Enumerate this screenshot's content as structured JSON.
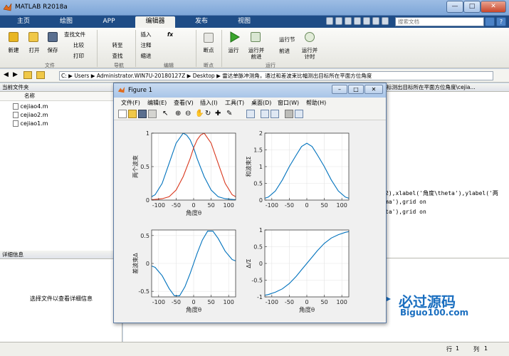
{
  "window": {
    "title": "MATLAB R2018a",
    "min": "—",
    "max": "□",
    "close": "✕"
  },
  "tabs": [
    "主页",
    "绘图",
    "APP",
    "编辑器",
    "发布",
    "视图"
  ],
  "search_placeholder": "搜索文档",
  "help": "?",
  "ribbon": {
    "file_group": {
      "label": "文件",
      "new": "新建",
      "open": "打开",
      "save": "保存",
      "find_files": "查找文件",
      "compare": "比较",
      "print": "打印"
    },
    "nav_group": {
      "label": "导航",
      "goto": "转至",
      "find": "查找"
    },
    "edit_group": {
      "label": "编辑",
      "insert": "插入",
      "comment": "注释",
      "indent": "缩进",
      "fx": "fx"
    },
    "breakpoint_group": {
      "label": "断点",
      "breakpoints": "断点"
    },
    "run_group": {
      "label": "运行",
      "run": "运行",
      "run_advance": "运行并\n前进",
      "run_section": "运行节",
      "advance": "前进",
      "run_time": "运行并\n计时"
    }
  },
  "path": {
    "segments": [
      "C:",
      "Users",
      "Administrator.WIN7U-20180127Z",
      "Desktop",
      "雷达单脉冲测角，通过和差波束比幅测出目标所在平面方位角度"
    ]
  },
  "current_folder": {
    "title": "当前文件夹",
    "column": "名称",
    "files": [
      "cejiao4.m",
      "cejiao2.m",
      "cejiao1.m"
    ]
  },
  "details": {
    "title": "详细信息",
    "hint": "选择文件以查看详细信息"
  },
  "editor": {
    "tab_title": "标测出目标所在平面方位角度\\cejia...",
    "lines": [
      "2),xlabel('角度\\theta'),ylabel('两",
      "ma'),grid on",
      "ta'),grid on"
    ]
  },
  "status": {
    "row_label": "行",
    "row": "1",
    "col_label": "列",
    "col": "1"
  },
  "watermark": {
    "cn": "必过源码",
    "en": "Biguo100.com"
  },
  "figure": {
    "title": "Figure 1",
    "menu": [
      "文件(F)",
      "编辑(E)",
      "查看(V)",
      "插入(I)",
      "工具(T)",
      "桌面(D)",
      "窗口(W)",
      "帮助(H)"
    ]
  },
  "colors": {
    "blue": "#0072bd",
    "red": "#d9381e",
    "tab_blue": "#1e4c86"
  },
  "chart_data": [
    {
      "type": "line",
      "xlabel": "角度θ",
      "ylabel": "两个波束",
      "xlim": [
        -120,
        120
      ],
      "ylim": [
        0,
        1
      ],
      "xticks": [
        -100,
        -50,
        0,
        50,
        100
      ],
      "yticks": [
        0,
        0.5,
        1
      ],
      "grid": true,
      "series": [
        {
          "color": "#0072bd",
          "x": [
            -130,
            -110,
            -90,
            -70,
            -50,
            -30,
            -20,
            -10,
            0,
            10,
            30,
            50,
            70,
            90,
            110,
            130
          ],
          "y": [
            0.02,
            0.08,
            0.25,
            0.55,
            0.85,
            1.0,
            0.97,
            0.9,
            0.78,
            0.62,
            0.35,
            0.15,
            0.05,
            0.02,
            0.01,
            0.0
          ]
        },
        {
          "color": "#d9381e",
          "x": [
            -130,
            -110,
            -90,
            -70,
            -50,
            -30,
            -10,
            0,
            10,
            20,
            30,
            50,
            70,
            90,
            110,
            130
          ],
          "y": [
            0.0,
            0.01,
            0.02,
            0.05,
            0.15,
            0.35,
            0.62,
            0.78,
            0.9,
            0.97,
            1.0,
            0.85,
            0.55,
            0.25,
            0.08,
            0.02
          ]
        }
      ]
    },
    {
      "type": "line",
      "xlabel": "",
      "ylabel": "和波束Σ",
      "xlim": [
        -120,
        120
      ],
      "ylim": [
        0,
        2
      ],
      "xticks": [
        -100,
        -50,
        0,
        50,
        100
      ],
      "yticks": [
        0,
        0.5,
        1,
        1.5,
        2
      ],
      "grid": true,
      "series": [
        {
          "color": "#0072bd",
          "x": [
            -130,
            -110,
            -90,
            -70,
            -50,
            -30,
            -15,
            0,
            15,
            30,
            50,
            70,
            90,
            110,
            130
          ],
          "y": [
            0.02,
            0.09,
            0.27,
            0.6,
            1.0,
            1.35,
            1.6,
            1.7,
            1.6,
            1.35,
            1.0,
            0.6,
            0.27,
            0.09,
            0.02
          ]
        }
      ]
    },
    {
      "type": "line",
      "xlabel": "角度θ",
      "ylabel": "差波束Δ",
      "xlim": [
        -120,
        120
      ],
      "ylim": [
        -0.6,
        0.6
      ],
      "xticks": [
        -100,
        -50,
        0,
        50,
        100
      ],
      "yticks": [
        -0.5,
        0,
        0.5
      ],
      "grid": true,
      "series": [
        {
          "color": "#0072bd",
          "x": [
            -130,
            -110,
            -90,
            -70,
            -55,
            -40,
            -25,
            -10,
            0,
            10,
            25,
            40,
            55,
            70,
            90,
            110,
            130
          ],
          "y": [
            -0.02,
            -0.07,
            -0.22,
            -0.45,
            -0.58,
            -0.58,
            -0.42,
            -0.18,
            0,
            0.18,
            0.42,
            0.58,
            0.58,
            0.45,
            0.22,
            0.07,
            0.02
          ]
        }
      ]
    },
    {
      "type": "line",
      "xlabel": "角度θ",
      "ylabel": "Δ/Σ",
      "xlim": [
        -120,
        120
      ],
      "ylim": [
        -1,
        1
      ],
      "xticks": [
        -100,
        -50,
        0,
        50,
        100
      ],
      "yticks": [
        -1,
        -0.5,
        0,
        0.5,
        1
      ],
      "grid": true,
      "series": [
        {
          "color": "#0072bd",
          "x": [
            -130,
            -110,
            -90,
            -70,
            -50,
            -30,
            -15,
            0,
            15,
            30,
            50,
            70,
            90,
            110,
            130
          ],
          "y": [
            -0.97,
            -0.93,
            -0.86,
            -0.76,
            -0.6,
            -0.38,
            -0.19,
            0,
            0.19,
            0.38,
            0.6,
            0.76,
            0.86,
            0.93,
            0.97
          ]
        }
      ]
    }
  ]
}
